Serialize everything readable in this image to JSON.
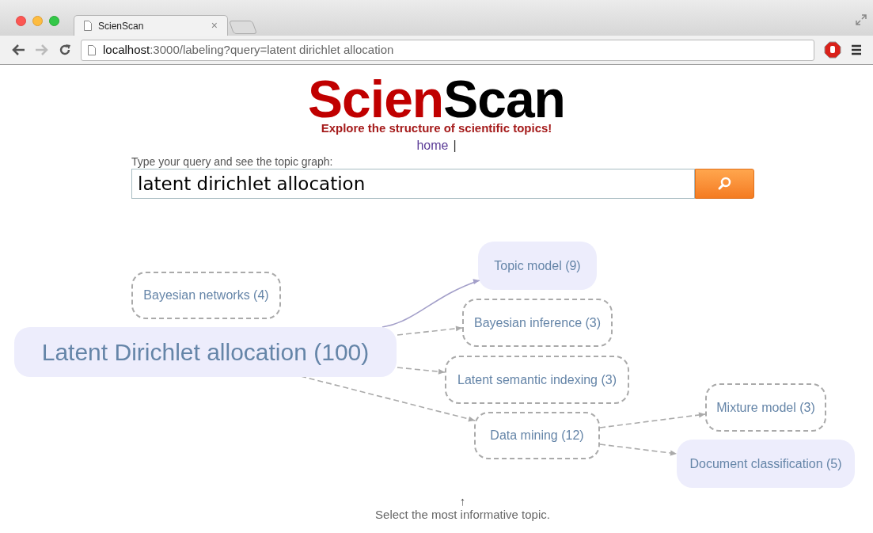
{
  "browser": {
    "tab": {
      "title": "ScienScan",
      "close": "×"
    },
    "address": {
      "host": "localhost",
      "rest": ":3000/labeling?query=latent dirichlet allocation"
    }
  },
  "header": {
    "logo": [
      {
        "text": "Scien",
        "color": "#c00000"
      },
      {
        "text": "Scan",
        "color": "#000000"
      }
    ],
    "tagline": "Explore the structure of scientific topics!",
    "nav": {
      "link": "home",
      "separator": "|"
    }
  },
  "search": {
    "label": "Type your query and see the topic graph:",
    "value": "latent dirichlet allocation"
  },
  "graph": {
    "nodes": [
      {
        "label": "Bayesian networks (4)",
        "highlighted": false
      },
      {
        "label": "Latent Dirichlet allocation (100)",
        "highlighted": true,
        "children": [
          {
            "label": "Topic model (9)",
            "highlighted": true,
            "kind": "solid"
          },
          {
            "label": "Bayesian inference (3)",
            "highlighted": false,
            "kind": "dashed"
          },
          {
            "label": "Latent semantic indexing (3)",
            "highlighted": false,
            "kind": "dashed"
          },
          {
            "label": "Data mining (12)",
            "highlighted": false,
            "kind": "dashed",
            "children": [
              {
                "label": "Mixture model (3)",
                "highlighted": false,
                "kind": "dashed"
              },
              {
                "label": "Document classification (5)",
                "highlighted": true,
                "kind": "dashed"
              }
            ]
          }
        ]
      }
    ]
  },
  "hint": {
    "arrow": "↑",
    "text": "Select the most informative topic."
  }
}
